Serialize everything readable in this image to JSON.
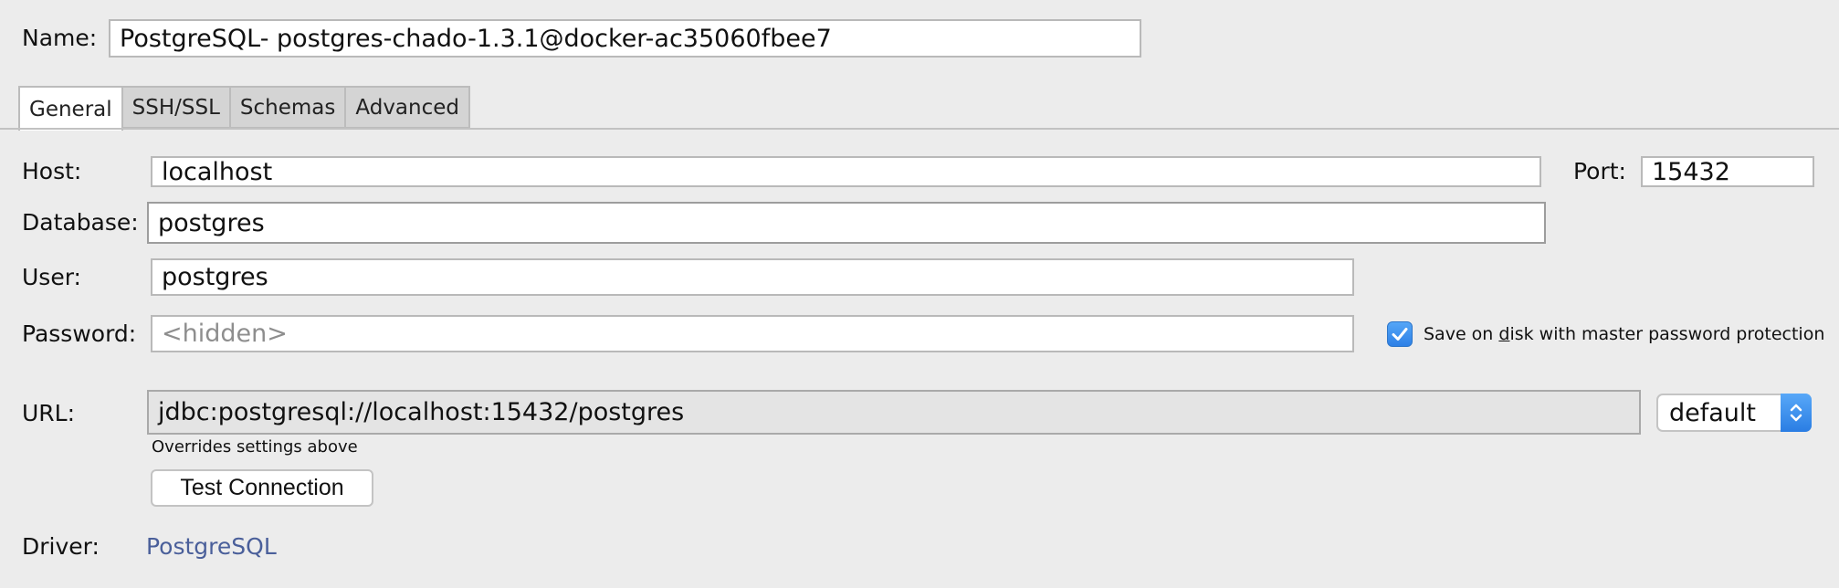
{
  "name": {
    "label": "Name:",
    "value": "PostgreSQL- postgres-chado-1.3.1@docker-ac35060fbee7"
  },
  "tabs": [
    {
      "label": "General",
      "active": true
    },
    {
      "label": "SSH/SSL",
      "active": false
    },
    {
      "label": "Schemas",
      "active": false
    },
    {
      "label": "Advanced",
      "active": false
    }
  ],
  "general": {
    "host": {
      "label": "Host:",
      "value": "localhost"
    },
    "port": {
      "label": "Port:",
      "value": "15432"
    },
    "database": {
      "label": "Database:",
      "value": "postgres"
    },
    "user": {
      "label": "User:",
      "value": "postgres"
    },
    "password": {
      "label": "Password:",
      "placeholder": "<hidden>"
    },
    "save_on_disk": {
      "checked": true,
      "label_pre": "Save on ",
      "label_mnemonic": "d",
      "label_post": "isk with master password protection"
    },
    "url": {
      "label": "URL:",
      "value": "jdbc:postgresql://localhost:15432/postgres",
      "hint": "Overrides settings above",
      "mode": "default"
    },
    "test_connection_label": "Test Connection",
    "driver": {
      "label": "Driver:",
      "value": "PostgreSQL"
    }
  },
  "colors": {
    "accent": "#2d80e6",
    "link": "#4a5f9a",
    "background": "#ececec"
  }
}
